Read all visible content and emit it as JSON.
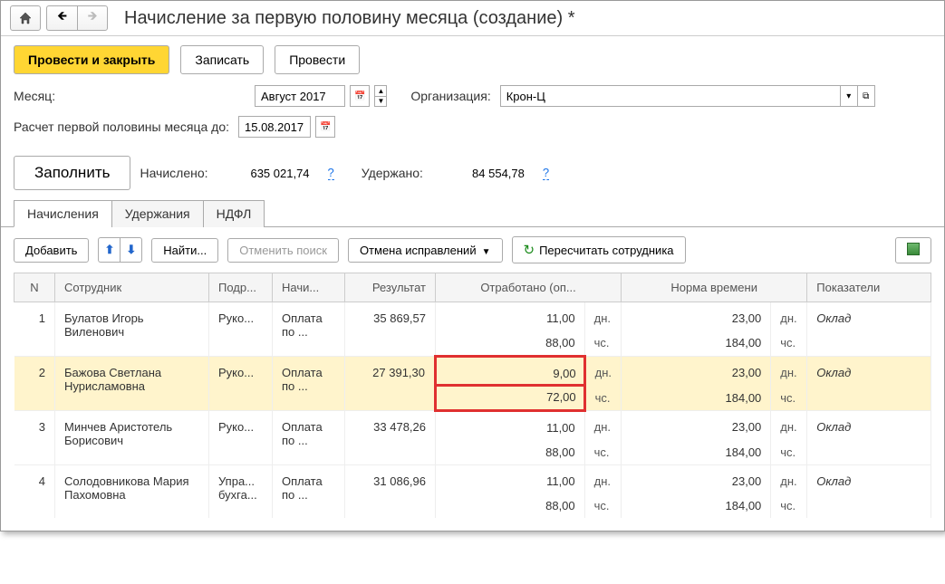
{
  "title": "Начисление за первую половину месяца (создание) *",
  "toolbar": {
    "post_close": "Провести и закрыть",
    "write": "Записать",
    "post": "Провести"
  },
  "fields": {
    "month_label": "Месяц:",
    "month_value": "Август 2017",
    "org_label": "Организация:",
    "org_value": "Крон-Ц",
    "half_label": "Расчет первой половины месяца до:",
    "half_value": "15.08.2017"
  },
  "summary": {
    "fill_label": "Заполнить",
    "accrued_label": "Начислено:",
    "accrued_value": "635 021,74",
    "withheld_label": "Удержано:",
    "withheld_value": "84 554,78",
    "q": "?"
  },
  "tabs": {
    "accruals": "Начисления",
    "withholdings": "Удержания",
    "ndfl": "НДФЛ"
  },
  "tab_toolbar": {
    "add": "Добавить",
    "find": "Найти...",
    "cancel_search": "Отменить поиск",
    "cancel_corrections": "Отмена исправлений",
    "recalc": "Пересчитать сотрудника"
  },
  "columns": {
    "n": "N",
    "employee": "Сотрудник",
    "dept": "Подр...",
    "accr": "Начи...",
    "result": "Результат",
    "worked": "Отработано (оп...",
    "norm": "Норма времени",
    "ind": "Показатели"
  },
  "units": {
    "days": "дн.",
    "hours": "чс."
  },
  "rows": [
    {
      "n": "1",
      "employee": "Булатов Игорь Виленович",
      "dept": "Руко...",
      "accr": "Оплата по ...",
      "result": "35 869,57",
      "worked_days": "11,00",
      "worked_hours": "88,00",
      "norm_days": "23,00",
      "norm_hours": "184,00",
      "ind": "Оклад",
      "highlighted": false
    },
    {
      "n": "2",
      "employee": "Бажова Светлана Нурисламовна",
      "dept": "Руко...",
      "accr": "Оплата по ...",
      "result": "27 391,30",
      "worked_days": "9,00",
      "worked_hours": "72,00",
      "norm_days": "23,00",
      "norm_hours": "184,00",
      "ind": "Оклад",
      "highlighted": true
    },
    {
      "n": "3",
      "employee": "Минчев Аристотель Борисович",
      "dept": "Руко...",
      "accr": "Оплата по ...",
      "result": "33 478,26",
      "worked_days": "11,00",
      "worked_hours": "88,00",
      "norm_days": "23,00",
      "norm_hours": "184,00",
      "ind": "Оклад",
      "highlighted": false
    },
    {
      "n": "4",
      "employee": "Солодовникова Мария Пахомовна",
      "dept": "Упра... бухга...",
      "accr": "Оплата по ...",
      "result": "31 086,96",
      "worked_days": "11,00",
      "worked_hours": "88,00",
      "norm_days": "23,00",
      "norm_hours": "184,00",
      "ind": "Оклад",
      "highlighted": false
    }
  ]
}
